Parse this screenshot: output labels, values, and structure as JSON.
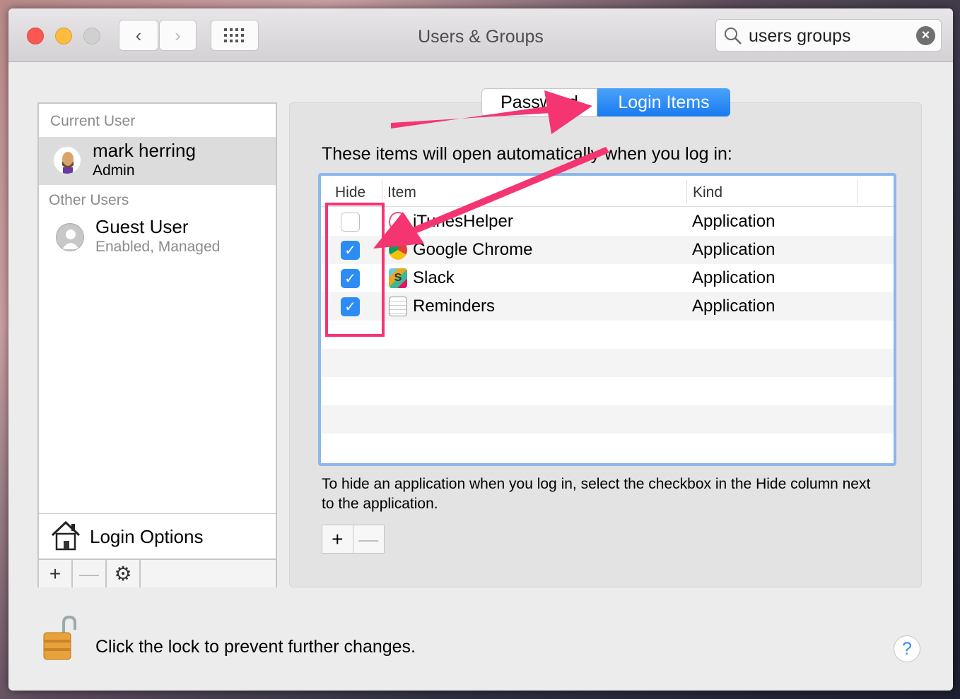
{
  "window": {
    "title": "Users & Groups"
  },
  "toolbar": {
    "back": "‹",
    "forward": "›",
    "grid_icon": "grid-icon"
  },
  "search": {
    "value": "users groups",
    "clear": "×"
  },
  "sidebar": {
    "current_user_header": "Current User",
    "current_user": {
      "name": "mark herring",
      "role": "Admin"
    },
    "other_users_header": "Other Users",
    "other_users": [
      {
        "name": "Guest User",
        "status": "Enabled, Managed"
      }
    ],
    "login_options": "Login Options",
    "add": "+",
    "remove": "—",
    "gear": "⚙"
  },
  "tabs": [
    {
      "label": "Password",
      "selected": false
    },
    {
      "label": "Login Items",
      "selected": true
    }
  ],
  "main": {
    "heading": "These items will open automatically when you log in:",
    "columns": {
      "hide": "Hide",
      "item": "Item",
      "kind": "Kind"
    },
    "rows": [
      {
        "hide": false,
        "name": "iTunesHelper",
        "kind": "Application",
        "icon": "itunes-icon"
      },
      {
        "hide": true,
        "name": "Google Chrome",
        "kind": "Application",
        "icon": "chrome-icon"
      },
      {
        "hide": true,
        "name": "Slack",
        "kind": "Application",
        "icon": "slack-icon"
      },
      {
        "hide": true,
        "name": "Reminders",
        "kind": "Application",
        "icon": "reminders-icon"
      }
    ],
    "caption": "To hide an application when you log in, select the checkbox in the Hide column next to the application.",
    "add": "+",
    "remove": "—"
  },
  "footer": {
    "lock_text": "Click the lock to prevent further changes.",
    "help": "?"
  },
  "colors": {
    "accent": "#2d8cf4",
    "annotation": "#f53572"
  }
}
